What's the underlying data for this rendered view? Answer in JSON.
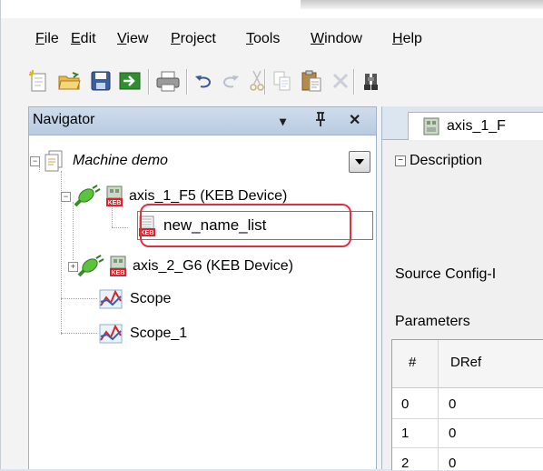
{
  "menu": {
    "file": {
      "mnemonic": "F",
      "rest": "ile"
    },
    "edit": {
      "mnemonic": "E",
      "rest": "dit"
    },
    "view": {
      "mnemonic": "V",
      "rest": "iew"
    },
    "project": {
      "mnemonic": "P",
      "rest": "roject"
    },
    "tools": {
      "mnemonic": "T",
      "rest": "ools"
    },
    "window": {
      "mnemonic": "W",
      "rest": "indow"
    },
    "help": {
      "mnemonic": "H",
      "rest": "elp"
    }
  },
  "toolbar": {
    "icons": [
      "new-document-icon",
      "open-folder-icon",
      "save-icon",
      "import-icon",
      "print-icon",
      "undo-icon",
      "redo-icon",
      "cut-icon",
      "copy-icon",
      "paste-icon",
      "delete-icon",
      "find-icon"
    ]
  },
  "navigator": {
    "title": "Navigator",
    "pin_glyph": "▾",
    "dock_glyph": "ᵖ",
    "close_glyph": "✕",
    "root": {
      "label": "Machine demo",
      "expander": "−"
    },
    "axis1": {
      "label": "axis_1_F5 (KEB Device)",
      "expander": "−"
    },
    "rename": {
      "value": "new_name_list"
    },
    "axis2": {
      "label": "axis_2_G6 (KEB Device)",
      "expander": "+"
    },
    "scope": {
      "label": "Scope"
    },
    "scope1": {
      "label": "Scope_1"
    }
  },
  "editor": {
    "tab_label": "axis_1_F",
    "description_label": "Description",
    "description_expander": "−",
    "source_label": "Source Config-I",
    "parameters_label": "Parameters",
    "grid": {
      "headers": [
        "#",
        "DRef"
      ],
      "rows": [
        [
          "0",
          "0"
        ],
        [
          "1",
          "0"
        ],
        [
          "2",
          "0"
        ]
      ]
    }
  },
  "colors": {
    "highlight": "#e0303d",
    "panel_header": "#c6d6ea",
    "keb_red": "#d8242f",
    "plug_green": "#4fb33a"
  }
}
